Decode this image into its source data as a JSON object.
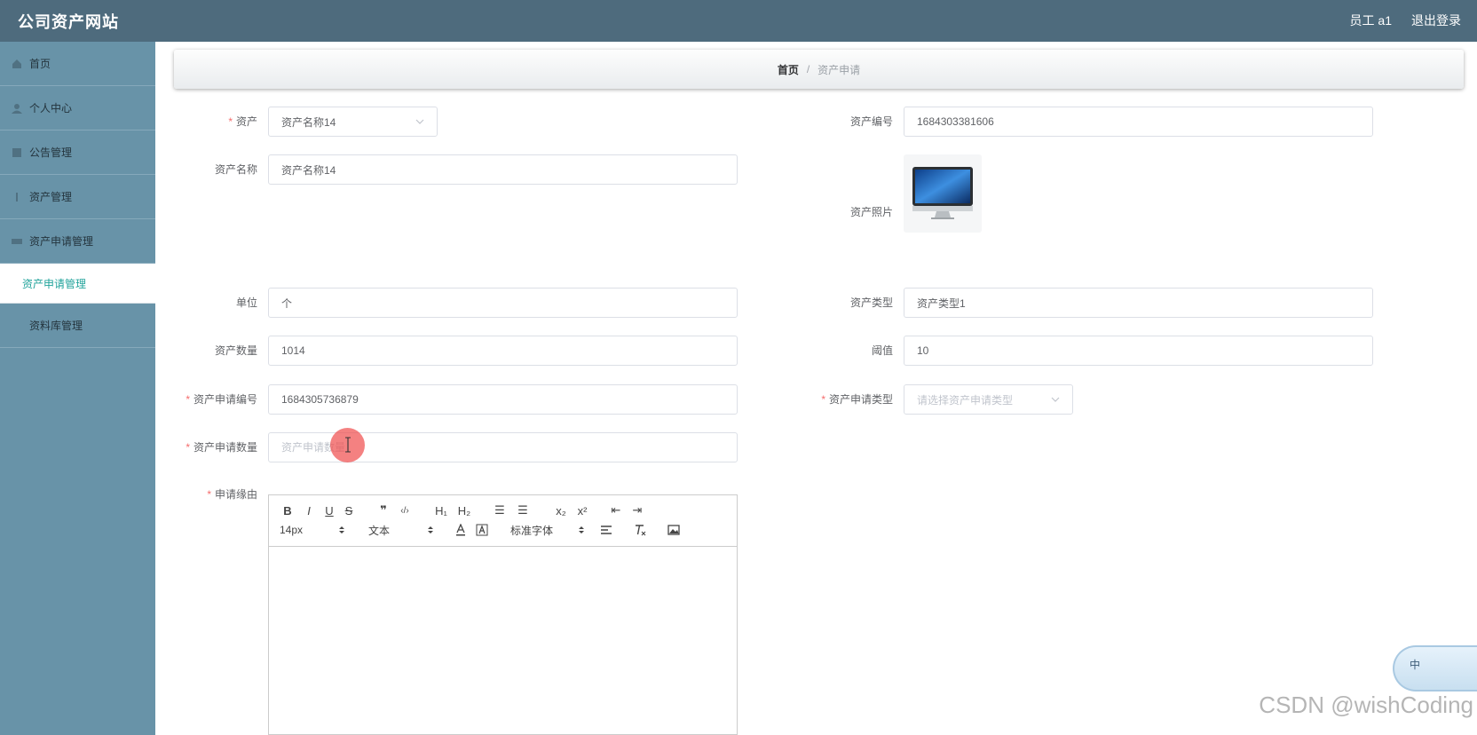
{
  "header": {
    "title": "公司资产网站",
    "user": "员工 a1",
    "logout": "退出登录"
  },
  "sidebar": {
    "items": [
      {
        "label": "首页",
        "icon": "home-icon"
      },
      {
        "label": "个人中心",
        "icon": "user-icon"
      },
      {
        "label": "公告管理",
        "icon": "notice-icon"
      },
      {
        "label": "资产管理",
        "icon": "asset-icon"
      },
      {
        "label": "资产申请管理",
        "icon": "apply-icon"
      }
    ],
    "active_sub": "资产申请管理",
    "last_item": {
      "label": "资料库管理",
      "icon": "library-icon"
    }
  },
  "breadcrumb": {
    "home": "首页",
    "separator": "/",
    "current": "资产申请"
  },
  "form": {
    "asset": {
      "label": "资产",
      "value": "资产名称14"
    },
    "asset_code": {
      "label": "资产编号",
      "value": "1684303381606"
    },
    "asset_name": {
      "label": "资产名称",
      "value": "资产名称14"
    },
    "asset_photo": {
      "label": "资产照片",
      "icon": "imac-image"
    },
    "unit": {
      "label": "单位",
      "value": "个"
    },
    "asset_type": {
      "label": "资产类型",
      "value": "资产类型1"
    },
    "asset_qty": {
      "label": "资产数量",
      "value": "1014"
    },
    "threshold": {
      "label": "阈值",
      "value": "10"
    },
    "apply_code": {
      "label": "资产申请编号",
      "value": "1684305736879"
    },
    "apply_type": {
      "label": "资产申请类型",
      "placeholder": "请选择资产申请类型"
    },
    "apply_qty": {
      "label": "资产申请数量",
      "placeholder": "资产申请数量"
    },
    "reason": {
      "label": "申请缘由"
    }
  },
  "editor": {
    "row1": [
      {
        "name": "bold",
        "label": "B"
      },
      {
        "name": "italic",
        "label": "I"
      },
      {
        "name": "underline",
        "label": "U"
      },
      {
        "name": "strike",
        "label": "S"
      },
      {
        "name": "blockquote",
        "label": "❞"
      },
      {
        "name": "code",
        "label": "‹/›"
      },
      {
        "name": "h1",
        "label": "H₁"
      },
      {
        "name": "h2",
        "label": "H₂"
      },
      {
        "name": "ordered-list",
        "label": "☰"
      },
      {
        "name": "bullet-list",
        "label": "☰"
      },
      {
        "name": "subscript",
        "label": "x₂"
      },
      {
        "name": "superscript",
        "label": "x²"
      },
      {
        "name": "outdent",
        "label": "⇤"
      },
      {
        "name": "indent",
        "label": "⇥"
      }
    ],
    "size": "14px",
    "header_select": "文本",
    "font_select": "标准字体"
  },
  "ime": {
    "label": "中"
  },
  "watermark": "CSDN @wishCoding",
  "colors": {
    "header_bg": "#4e6b7d",
    "sidebar_bg": "#6893a8",
    "accent": "#21a39b",
    "required": "#f56c6c"
  }
}
